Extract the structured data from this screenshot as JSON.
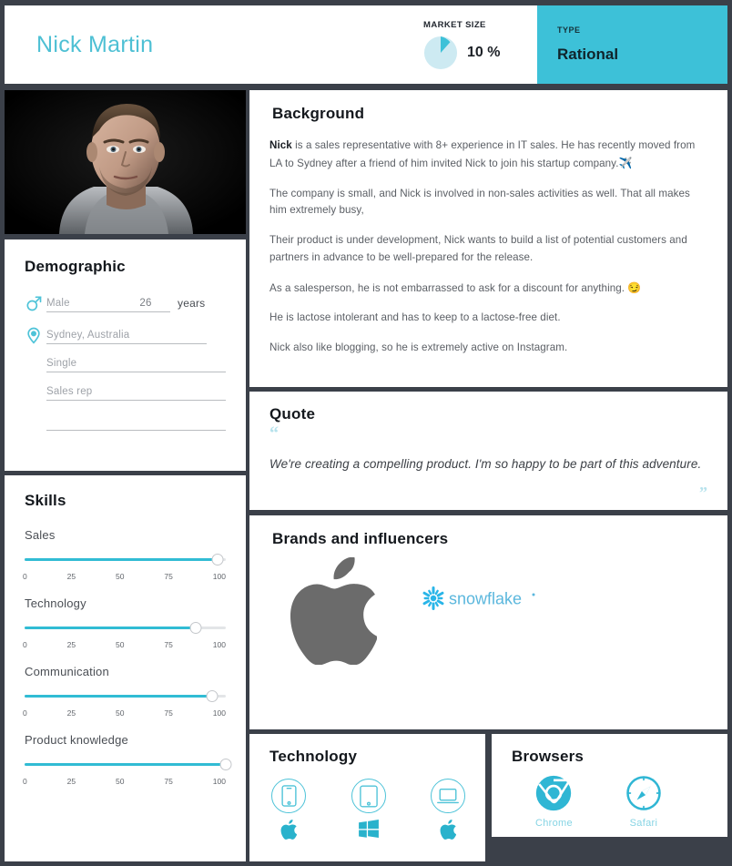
{
  "header": {
    "persona_name": "Nick Martin",
    "market_size_label": "MARKET SIZE",
    "market_size_value": "10 %",
    "market_size_percent": 10,
    "type_label": "TYPE",
    "type_value": "Rational",
    "accent_color": "#3dc1d8",
    "pie_fill_color": "#cdeaf2",
    "pie_slice_color": "#3dc1d8"
  },
  "photo": {
    "alt": "portrait-photo"
  },
  "demographic": {
    "title": "Demographic",
    "gender": "Male",
    "age": "26",
    "age_unit": "years",
    "location": "Sydney, Australia",
    "marital_status": "Single",
    "occupation": "Sales rep",
    "extra": ""
  },
  "skills": {
    "title": "Skills",
    "tick_labels": [
      "0",
      "25",
      "50",
      "75",
      "100"
    ],
    "items": [
      {
        "label": "Sales",
        "value": 96
      },
      {
        "label": "Technology",
        "value": 85
      },
      {
        "label": "Communication",
        "value": 93
      },
      {
        "label": "Product knowledge",
        "value": 100
      }
    ]
  },
  "background": {
    "title": "Background",
    "paragraphs": [
      {
        "lead": "Nick",
        "text": " is a sales representative with 8+ experience in IT sales. He has recently moved from LA to Sydney after a friend of him invited Nick to join his startup company.",
        "emoji": "✈️"
      },
      {
        "lead": "",
        "text": "The company is small, and Nick is involved in non-sales activities as well. That all makes him extremely busy,",
        "emoji": ""
      },
      {
        "lead": "",
        "text": "Their product is under development, Nick wants to build a list of potential customers and partners in advance to be well-prepared for the release.",
        "emoji": ""
      },
      {
        "lead": "",
        "text": "As a salesperson, he is not embarrassed to ask for a discount for anything. ",
        "emoji": "😏"
      },
      {
        "lead": "",
        "text": "He is lactose intolerant and has to keep to a lactose-free diet.",
        "emoji": ""
      },
      {
        "lead": "",
        "text": "Nick also like blogging, so he is extremely active on Instagram.",
        "emoji": ""
      }
    ]
  },
  "quote": {
    "title": "Quote",
    "open_mark": "“",
    "close_mark": "”",
    "text": "We're creating a compelling product. I'm so happy to be part of this adventure."
  },
  "brands": {
    "title": "Brands and influencers",
    "items": [
      {
        "name": "Apple",
        "icon": "apple-logo",
        "color": "#6b6b6b"
      },
      {
        "name": "snowflake",
        "icon": "snowflake-logo",
        "color": "#29b5e8"
      }
    ]
  },
  "technology": {
    "title": "Technology",
    "accent": "#4ec3d8",
    "items": [
      {
        "device": "smartphone",
        "os": "apple-logo"
      },
      {
        "device": "tablet",
        "os": "windows-logo"
      },
      {
        "device": "laptop",
        "os": "apple-logo"
      }
    ]
  },
  "browsers": {
    "title": "Browsers",
    "items": [
      {
        "label": "Chrome",
        "icon": "chrome-logo"
      },
      {
        "label": "Safari",
        "icon": "safari-logo"
      }
    ]
  }
}
